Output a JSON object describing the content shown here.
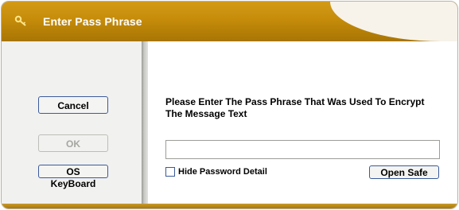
{
  "window": {
    "title": "Enter Pass Phrase",
    "title_icon": "key-icon"
  },
  "left_panel": {
    "cancel_label": "Cancel",
    "ok_label": "OK",
    "keyboard_label": "OS KeyBoard"
  },
  "main": {
    "prompt": "Please Enter The Pass Phrase That Was Used To Encrypt The Message Text",
    "pass_phrase_value": "",
    "hide_label": "Hide Password Detail",
    "hide_checked": false,
    "open_label": "Open Safe"
  },
  "colors": {
    "title_bar": "#c58c0a",
    "button_border": "#3b5a9a",
    "disabled_text": "#a5a5a1"
  }
}
